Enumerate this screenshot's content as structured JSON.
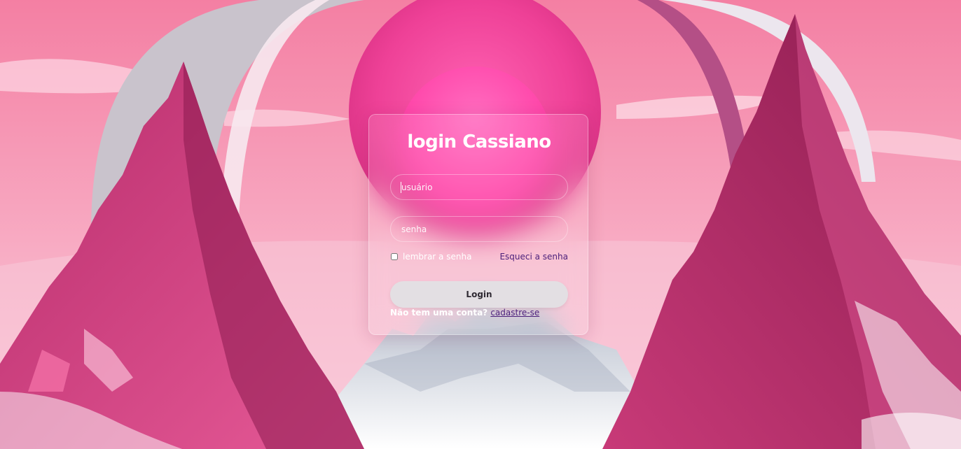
{
  "login": {
    "title": "login Cassiano",
    "username_placeholder": "usuário",
    "password_placeholder": "senha",
    "remember_label": "lembrar a senha",
    "forgot_link": "Esqueci a senha",
    "submit_label": "Login",
    "no_account_text": "Não tem uma conta?",
    "signup_link": "cadastre-se"
  },
  "theme": {
    "sky_pink": "#f48fb1",
    "magenta": "#e91e8c",
    "mountain_dark": "#8a1a4e",
    "button_bg": "#e3dfe3",
    "link_color": "#4b1f7a"
  }
}
